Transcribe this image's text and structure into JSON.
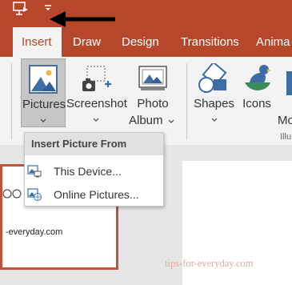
{
  "tabs": [
    {
      "label": "Insert",
      "active": true
    },
    {
      "label": "Draw"
    },
    {
      "label": "Design"
    },
    {
      "label": "Transitions"
    },
    {
      "label": "Anima"
    }
  ],
  "ribbon": {
    "pictures": {
      "label": "Pictures",
      "icon": "pictures-icon"
    },
    "screenshot": {
      "label": "Screenshot",
      "icon": "screenshot-icon"
    },
    "photo_album": {
      "line1": "Photo",
      "line2": "Album",
      "icon": "photo-album-icon"
    },
    "shapes": {
      "label": "Shapes",
      "icon": "shapes-icon"
    },
    "icons": {
      "label": "Icons",
      "icon": "icons-icon"
    },
    "models_partial": "Mo",
    "illustrations_partial": "Illu"
  },
  "menu": {
    "header": "Insert Picture From",
    "items": [
      {
        "label": "This Device...",
        "icon": "this-device-icon"
      },
      {
        "label": "Online Pictures...",
        "icon": "online-pictures-icon"
      }
    ]
  },
  "slide_thumbnail": {
    "caption": "-everyday.com"
  },
  "watermark": "tips-for-everyday.com",
  "colors": {
    "accent": "#b7472a",
    "ribbon": "#f3f3f3",
    "selected_button": "#c6c6c6"
  }
}
